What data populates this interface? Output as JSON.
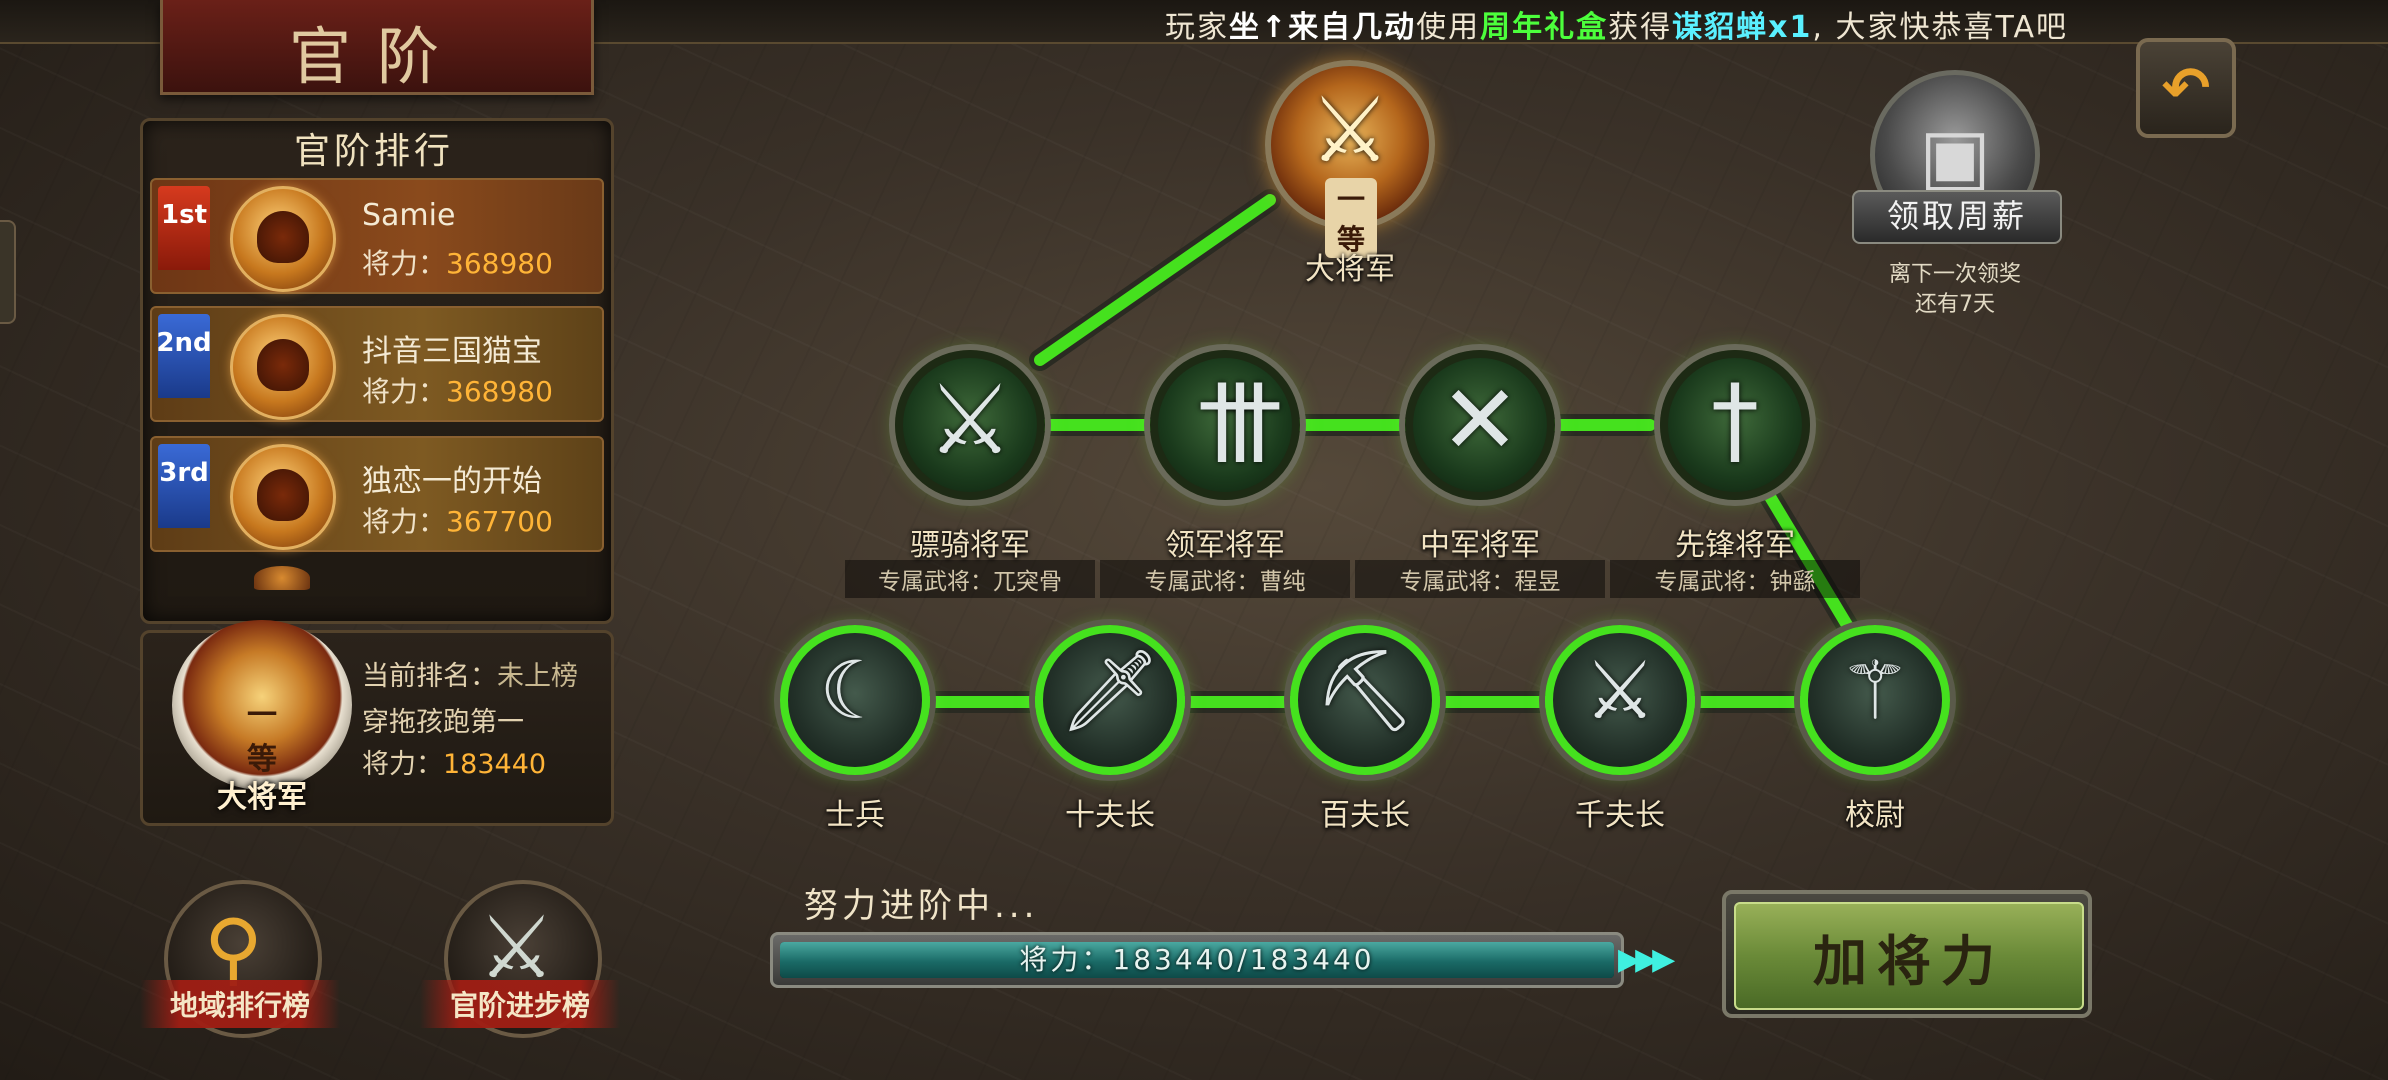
{
  "ticker": {
    "prefix": "玩家",
    "player": "坐↑来自几动",
    "mid": "使用",
    "item": "周年礼盒",
    "got": "获得",
    "reward": "谋貂蝉x1",
    "suffix": ", 大家快恭喜TA吧"
  },
  "title": "官阶",
  "ranking": {
    "title": "官阶排行",
    "power_label": "将力：",
    "rows": [
      {
        "ribbon": "1st",
        "name": "Samie",
        "power": "368980"
      },
      {
        "ribbon": "2nd",
        "name": "抖音三国猫宝",
        "power": "368980"
      },
      {
        "ribbon": "3rd",
        "name": "独恋一的开始",
        "power": "367700"
      }
    ]
  },
  "my_rank": {
    "rank_title": "大将军",
    "badge_grade": "一等",
    "current_rank_label": "当前排名：",
    "current_rank_value": "未上榜",
    "player_name": "穿拖孩跑第一",
    "power_label": "将力：",
    "power_value": "183440"
  },
  "bottom_buttons": {
    "region": "地域排行榜",
    "progress": "官阶进步榜"
  },
  "tree": {
    "top": {
      "label": "大将军",
      "grade": "一等"
    },
    "generals": [
      {
        "label": "骠骑将军",
        "sub": "专属武将：兀突骨"
      },
      {
        "label": "领军将军",
        "sub": "专属武将：曹纯"
      },
      {
        "label": "中军将军",
        "sub": "专属武将：程昱"
      },
      {
        "label": "先锋将军",
        "sub": "专属武将：钟繇"
      }
    ],
    "ranks": [
      {
        "label": "士兵"
      },
      {
        "label": "十夫长"
      },
      {
        "label": "百夫长"
      },
      {
        "label": "千夫长"
      },
      {
        "label": "校尉"
      }
    ]
  },
  "progress": {
    "caption": "努力进阶中...",
    "text": "将力：183440/183440",
    "fraction": 1.0
  },
  "add_button": "加将力",
  "weekly": {
    "label": "领取周薪",
    "sub1": "离下一次领奖",
    "sub2": "还有7天"
  },
  "colors": {
    "path_green": "#45e11e",
    "power_orange": "#ffb437",
    "progress_teal": "#1a6a66"
  }
}
